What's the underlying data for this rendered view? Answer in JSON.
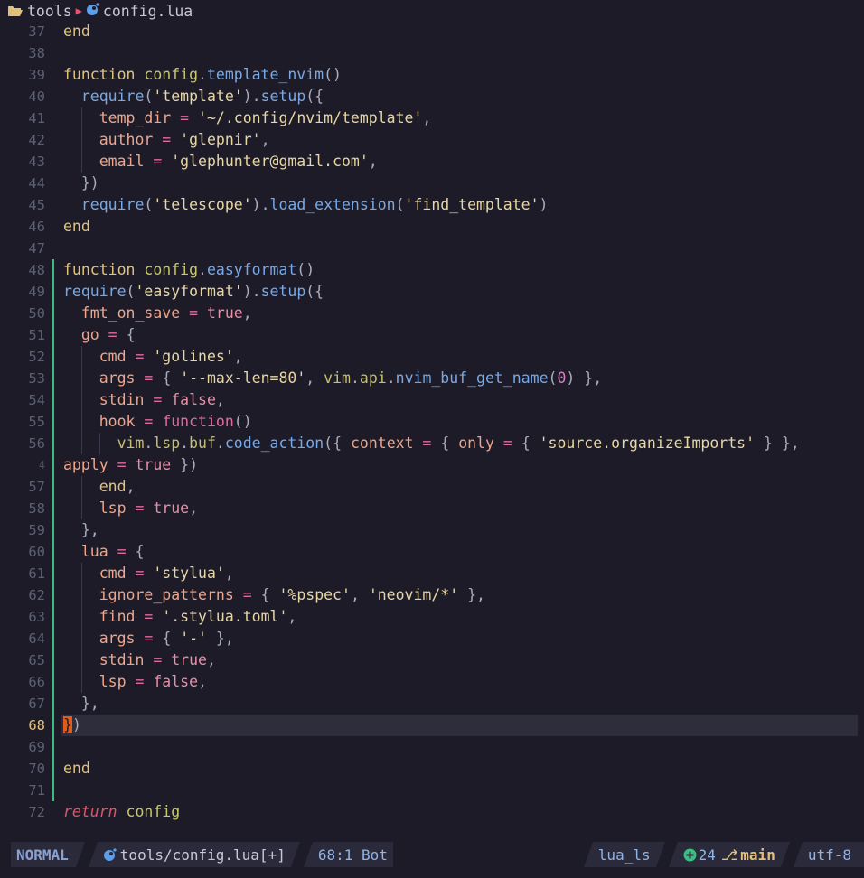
{
  "winbar": {
    "folder": "tools",
    "file": "config.lua"
  },
  "colors": {
    "background": "#1c1b27",
    "git_added": "#3bbf80",
    "cursor": "#e35a1f"
  },
  "cursor_line": 68,
  "lines": [
    {
      "n": "37",
      "tokens": [
        [
          "kw",
          "end"
        ]
      ]
    },
    {
      "n": "38",
      "tokens": []
    },
    {
      "n": "39",
      "tokens": [
        [
          "kw",
          "function "
        ],
        [
          "fn",
          "config"
        ],
        [
          "punc",
          "."
        ],
        [
          "method",
          "template_nvim"
        ],
        [
          "punc",
          "()"
        ]
      ]
    },
    {
      "n": "40",
      "tokens": [
        [
          "",
          "  "
        ],
        [
          "method",
          "require"
        ],
        [
          "punc",
          "("
        ],
        [
          "str",
          "'template'"
        ],
        [
          "punc",
          ")."
        ],
        [
          "method",
          "setup"
        ],
        [
          "punc",
          "({"
        ]
      ]
    },
    {
      "n": "41",
      "tokens": [
        [
          "",
          "    "
        ],
        [
          "prop",
          "temp_dir"
        ],
        [
          "op",
          " = "
        ],
        [
          "str",
          "'~/.config/nvim/template'"
        ],
        [
          "punc",
          ","
        ]
      ]
    },
    {
      "n": "42",
      "tokens": [
        [
          "",
          "    "
        ],
        [
          "prop",
          "author"
        ],
        [
          "op",
          " = "
        ],
        [
          "str",
          "'glepnir'"
        ],
        [
          "punc",
          ","
        ]
      ]
    },
    {
      "n": "43",
      "tokens": [
        [
          "",
          "    "
        ],
        [
          "prop",
          "email"
        ],
        [
          "op",
          " = "
        ],
        [
          "str",
          "'glephunter@gmail.com'"
        ],
        [
          "punc",
          ","
        ]
      ]
    },
    {
      "n": "44",
      "tokens": [
        [
          "",
          "  "
        ],
        [
          "punc",
          "})"
        ]
      ]
    },
    {
      "n": "45",
      "tokens": [
        [
          "",
          "  "
        ],
        [
          "method",
          "require"
        ],
        [
          "punc",
          "("
        ],
        [
          "str",
          "'telescope'"
        ],
        [
          "punc",
          ")."
        ],
        [
          "method",
          "load_extension"
        ],
        [
          "punc",
          "("
        ],
        [
          "str",
          "'find_template'"
        ],
        [
          "punc",
          ")"
        ]
      ]
    },
    {
      "n": "46",
      "tokens": [
        [
          "kw",
          "end"
        ]
      ]
    },
    {
      "n": "47",
      "tokens": []
    },
    {
      "n": "48",
      "git": true,
      "tokens": [
        [
          "kw",
          "function "
        ],
        [
          "fn",
          "config"
        ],
        [
          "punc",
          "."
        ],
        [
          "method",
          "easyformat"
        ],
        [
          "punc",
          "()"
        ]
      ]
    },
    {
      "n": "49",
      "git": true,
      "tokens": [
        [
          "method",
          "require"
        ],
        [
          "punc",
          "("
        ],
        [
          "str",
          "'easyformat'"
        ],
        [
          "punc",
          ")."
        ],
        [
          "method",
          "setup"
        ],
        [
          "punc",
          "({"
        ]
      ]
    },
    {
      "n": "50",
      "git": true,
      "tokens": [
        [
          "",
          "  "
        ],
        [
          "prop",
          "fmt_on_save"
        ],
        [
          "op",
          " = "
        ],
        [
          "bool",
          "true"
        ],
        [
          "punc",
          ","
        ]
      ]
    },
    {
      "n": "51",
      "git": true,
      "tokens": [
        [
          "",
          "  "
        ],
        [
          "prop",
          "go"
        ],
        [
          "op",
          " = "
        ],
        [
          "punc",
          "{"
        ]
      ]
    },
    {
      "n": "52",
      "git": true,
      "tokens": [
        [
          "",
          "    "
        ],
        [
          "prop",
          "cmd"
        ],
        [
          "op",
          " = "
        ],
        [
          "str",
          "'golines'"
        ],
        [
          "punc",
          ","
        ]
      ]
    },
    {
      "n": "53",
      "git": true,
      "tokens": [
        [
          "",
          "    "
        ],
        [
          "prop",
          "args"
        ],
        [
          "op",
          " = "
        ],
        [
          "punc",
          "{ "
        ],
        [
          "str",
          "'--max-len=80'"
        ],
        [
          "punc",
          ", "
        ],
        [
          "vimv",
          "vim"
        ],
        [
          "punc",
          "."
        ],
        [
          "vimv",
          "api"
        ],
        [
          "punc",
          "."
        ],
        [
          "method",
          "nvim_buf_get_name"
        ],
        [
          "punc",
          "("
        ],
        [
          "num",
          "0"
        ],
        [
          "punc",
          ") },"
        ]
      ]
    },
    {
      "n": "54",
      "git": true,
      "tokens": [
        [
          "",
          "    "
        ],
        [
          "prop",
          "stdin"
        ],
        [
          "op",
          " = "
        ],
        [
          "bool",
          "false"
        ],
        [
          "punc",
          ","
        ]
      ]
    },
    {
      "n": "55",
      "git": true,
      "tokens": [
        [
          "",
          "    "
        ],
        [
          "prop",
          "hook"
        ],
        [
          "op",
          " = "
        ],
        [
          "op",
          "function"
        ],
        [
          "punc",
          "()"
        ]
      ]
    },
    {
      "n": "56",
      "git": true,
      "tokens": [
        [
          "",
          "      "
        ],
        [
          "vimv",
          "vim"
        ],
        [
          "punc",
          "."
        ],
        [
          "vimv",
          "lsp"
        ],
        [
          "punc",
          "."
        ],
        [
          "vimv",
          "buf"
        ],
        [
          "punc",
          "."
        ],
        [
          "method",
          "code_action"
        ],
        [
          "punc",
          "({ "
        ],
        [
          "prop",
          "context"
        ],
        [
          "op",
          " = "
        ],
        [
          "punc",
          "{ "
        ],
        [
          "prop",
          "only"
        ],
        [
          "op",
          " = "
        ],
        [
          "punc",
          "{ "
        ],
        [
          "str",
          "'source.organizeImports'"
        ],
        [
          "punc",
          " } },"
        ]
      ]
    },
    {
      "n": "4",
      "wrap": true,
      "git": true,
      "tokens": [
        [
          "prop",
          "apply"
        ],
        [
          "op",
          " = "
        ],
        [
          "bool",
          "true"
        ],
        [
          "punc",
          " })"
        ]
      ]
    },
    {
      "n": "57",
      "git": true,
      "tokens": [
        [
          "",
          "    "
        ],
        [
          "kw",
          "end"
        ],
        [
          "punc",
          ","
        ]
      ]
    },
    {
      "n": "58",
      "git": true,
      "tokens": [
        [
          "",
          "    "
        ],
        [
          "prop",
          "lsp"
        ],
        [
          "op",
          " = "
        ],
        [
          "bool",
          "true"
        ],
        [
          "punc",
          ","
        ]
      ]
    },
    {
      "n": "59",
      "git": true,
      "tokens": [
        [
          "",
          "  "
        ],
        [
          "punc",
          "},"
        ]
      ]
    },
    {
      "n": "60",
      "git": true,
      "tokens": [
        [
          "",
          "  "
        ],
        [
          "prop",
          "lua"
        ],
        [
          "op",
          " = "
        ],
        [
          "punc",
          "{"
        ]
      ]
    },
    {
      "n": "61",
      "git": true,
      "tokens": [
        [
          "",
          "    "
        ],
        [
          "prop",
          "cmd"
        ],
        [
          "op",
          " = "
        ],
        [
          "str",
          "'stylua'"
        ],
        [
          "punc",
          ","
        ]
      ]
    },
    {
      "n": "62",
      "git": true,
      "tokens": [
        [
          "",
          "    "
        ],
        [
          "prop",
          "ignore_patterns"
        ],
        [
          "op",
          " = "
        ],
        [
          "punc",
          "{ "
        ],
        [
          "str",
          "'%pspec'"
        ],
        [
          "punc",
          ", "
        ],
        [
          "str",
          "'neovim/*'"
        ],
        [
          "punc",
          " },"
        ]
      ]
    },
    {
      "n": "63",
      "git": true,
      "tokens": [
        [
          "",
          "    "
        ],
        [
          "prop",
          "find"
        ],
        [
          "op",
          " = "
        ],
        [
          "str",
          "'.stylua.toml'"
        ],
        [
          "punc",
          ","
        ]
      ]
    },
    {
      "n": "64",
      "git": true,
      "tokens": [
        [
          "",
          "    "
        ],
        [
          "prop",
          "args"
        ],
        [
          "op",
          " = "
        ],
        [
          "punc",
          "{ "
        ],
        [
          "str",
          "'-'"
        ],
        [
          "punc",
          " },"
        ]
      ]
    },
    {
      "n": "65",
      "git": true,
      "tokens": [
        [
          "",
          "    "
        ],
        [
          "prop",
          "stdin"
        ],
        [
          "op",
          " = "
        ],
        [
          "bool",
          "true"
        ],
        [
          "punc",
          ","
        ]
      ]
    },
    {
      "n": "66",
      "git": true,
      "tokens": [
        [
          "",
          "    "
        ],
        [
          "prop",
          "lsp"
        ],
        [
          "op",
          " = "
        ],
        [
          "bool",
          "false"
        ],
        [
          "punc",
          ","
        ]
      ]
    },
    {
      "n": "67",
      "git": true,
      "tokens": [
        [
          "",
          "  "
        ],
        [
          "punc",
          "},"
        ]
      ]
    },
    {
      "n": "68",
      "git": true,
      "cur": true,
      "tokens": [
        [
          "cursor",
          "}"
        ],
        [
          "punc",
          ")"
        ]
      ]
    },
    {
      "n": "69",
      "git": true,
      "tokens": []
    },
    {
      "n": "70",
      "git": true,
      "tokens": [
        [
          "kw",
          "end"
        ]
      ]
    },
    {
      "n": "71",
      "git": true,
      "tokens": []
    },
    {
      "n": "72",
      "tokens": [
        [
          "ret",
          "return"
        ],
        [
          "",
          ""
        ],
        [
          "fn",
          " config"
        ]
      ]
    }
  ],
  "statusline": {
    "mode": "NORMAL",
    "file": "tools/config.lua[+]",
    "position": "68:1 Bot",
    "lsp": "lua_ls",
    "git_added": "24",
    "branch": "main",
    "encoding": "utf-8",
    "icons": {
      "git_add": "plus-circle-icon",
      "branch": "git-branch-icon",
      "lua": "lua-icon"
    }
  }
}
